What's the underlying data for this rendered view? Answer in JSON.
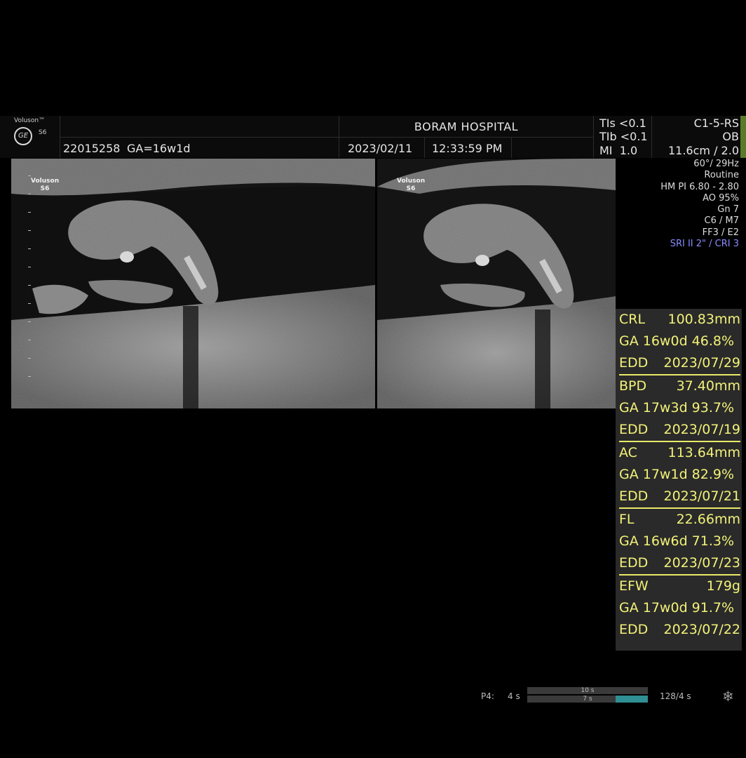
{
  "header": {
    "brand": "Voluson™",
    "model": "S6",
    "logo_icon": "ge-logo-icon",
    "patient_id": "22015258",
    "ga": "GA=16w1d",
    "hospital": "BORAM HOSPITAL",
    "date": "2023/02/11",
    "time": "12:33:59 PM",
    "safety": {
      "tis": "TIs <0.1",
      "tib": "TIb <0.1",
      "mi": "MI  1.0"
    },
    "probe": {
      "name": "C1-5-RS",
      "app": "OB",
      "depth": "11.6cm / 2.0"
    }
  },
  "panes": {
    "left_label": "Voluson\nS6",
    "right_label": "Voluson\nS6"
  },
  "params": {
    "angle_rate": "60°/ 29Hz",
    "preset": "Routine",
    "harmonic": "HM PI 6.80 - 2.80",
    "ao": "AO 95%",
    "gain": "Gn  7",
    "map": "C6 / M7",
    "ff": "FF3 / E2",
    "sri": "SRI II 2\" / CRI 3"
  },
  "measurements": [
    {
      "name": "CRL",
      "value": "100.83mm",
      "ga": "GA 16w0d 46.8%",
      "edd": "2023/07/29"
    },
    {
      "name": "BPD",
      "value": "37.40mm",
      "ga": "GA 17w3d 93.7%",
      "edd": "2023/07/19"
    },
    {
      "name": "AC",
      "value": "113.64mm",
      "ga": "GA 17w1d 82.9%",
      "edd": "2023/07/21"
    },
    {
      "name": "FL",
      "value": "22.66mm",
      "ga": "GA 16w6d 71.3%",
      "edd": "2023/07/23"
    },
    {
      "name": "EFW",
      "value": "179g",
      "ga": "GA 17w0d 91.7%",
      "edd": "2023/07/22"
    }
  ],
  "edd_label": "EDD",
  "cine": {
    "label": "P4:",
    "value": "4 s",
    "bar1": "10 s",
    "bar2": "7 s",
    "frames": "128/4 s",
    "fill_fraction": 0.27
  },
  "colors": {
    "measure_text": "#f2f27a",
    "measure_bg": "#2a2a2a",
    "sri_text": "#8a8aff",
    "cine_fill": "#2f8f92"
  }
}
